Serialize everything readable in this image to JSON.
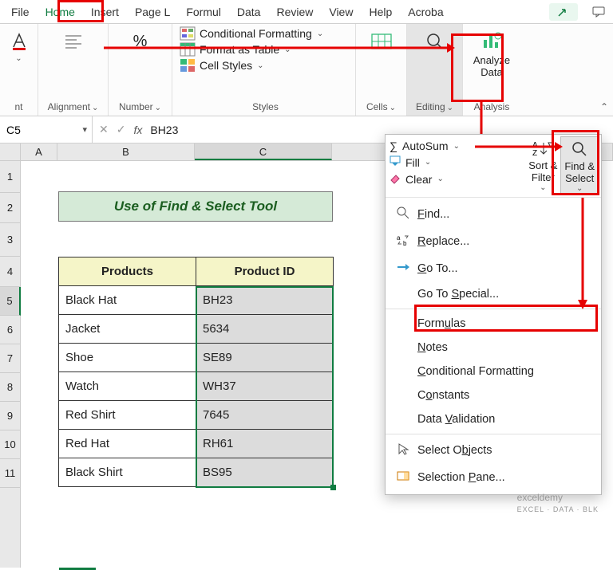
{
  "tabs": [
    "File",
    "Home",
    "Insert",
    "Page L",
    "Formul",
    "Data",
    "Review",
    "View",
    "Help",
    "Acroba"
  ],
  "ribbon": {
    "font_group": "nt",
    "alignment": "Alignment",
    "number": "Number",
    "styles_label": "Styles",
    "cond_fmt": "Conditional Formatting",
    "fmt_table": "Format as Table",
    "cell_styles": "Cell Styles",
    "cells": "Cells",
    "editing": "Editing",
    "analyze": "Analyze",
    "data": "Data",
    "analysis": "Analysis"
  },
  "namebox": "C5",
  "formula": "BH23",
  "title_cell": "Use of Find & Select Tool",
  "headers": {
    "products": "Products",
    "pid": "Product ID"
  },
  "rows": [
    {
      "p": "Black Hat",
      "id": "BH23"
    },
    {
      "p": "Jacket",
      "id": "5634"
    },
    {
      "p": "Shoe",
      "id": "SE89"
    },
    {
      "p": "Watch",
      "id": "WH37"
    },
    {
      "p": "Red Shirt",
      "id": "7645"
    },
    {
      "p": "Red Hat",
      "id": "RH61"
    },
    {
      "p": "Black Shirt",
      "id": "BS95"
    }
  ],
  "editmenu": {
    "autosum": "AutoSum",
    "fill": "Fill",
    "clear": "Clear",
    "sortfilter": "Sort &",
    "filter2": "Filter",
    "findsel": "Find &",
    "select2": "Select",
    "items": {
      "find": "Find...",
      "replace": "Replace...",
      "goto": "Go To...",
      "gts": "Go To Special...",
      "formulas": "Formulas",
      "notes": "Notes",
      "condfmt": "Conditional Formatting",
      "constants": "Constants",
      "dataval": "Data Validation",
      "selobj": "Select Objects",
      "selpane": "Selection Pane..."
    }
  },
  "watermark": {
    "a": "exceldemy",
    "b": "EXCEL · DATA · BLK"
  }
}
